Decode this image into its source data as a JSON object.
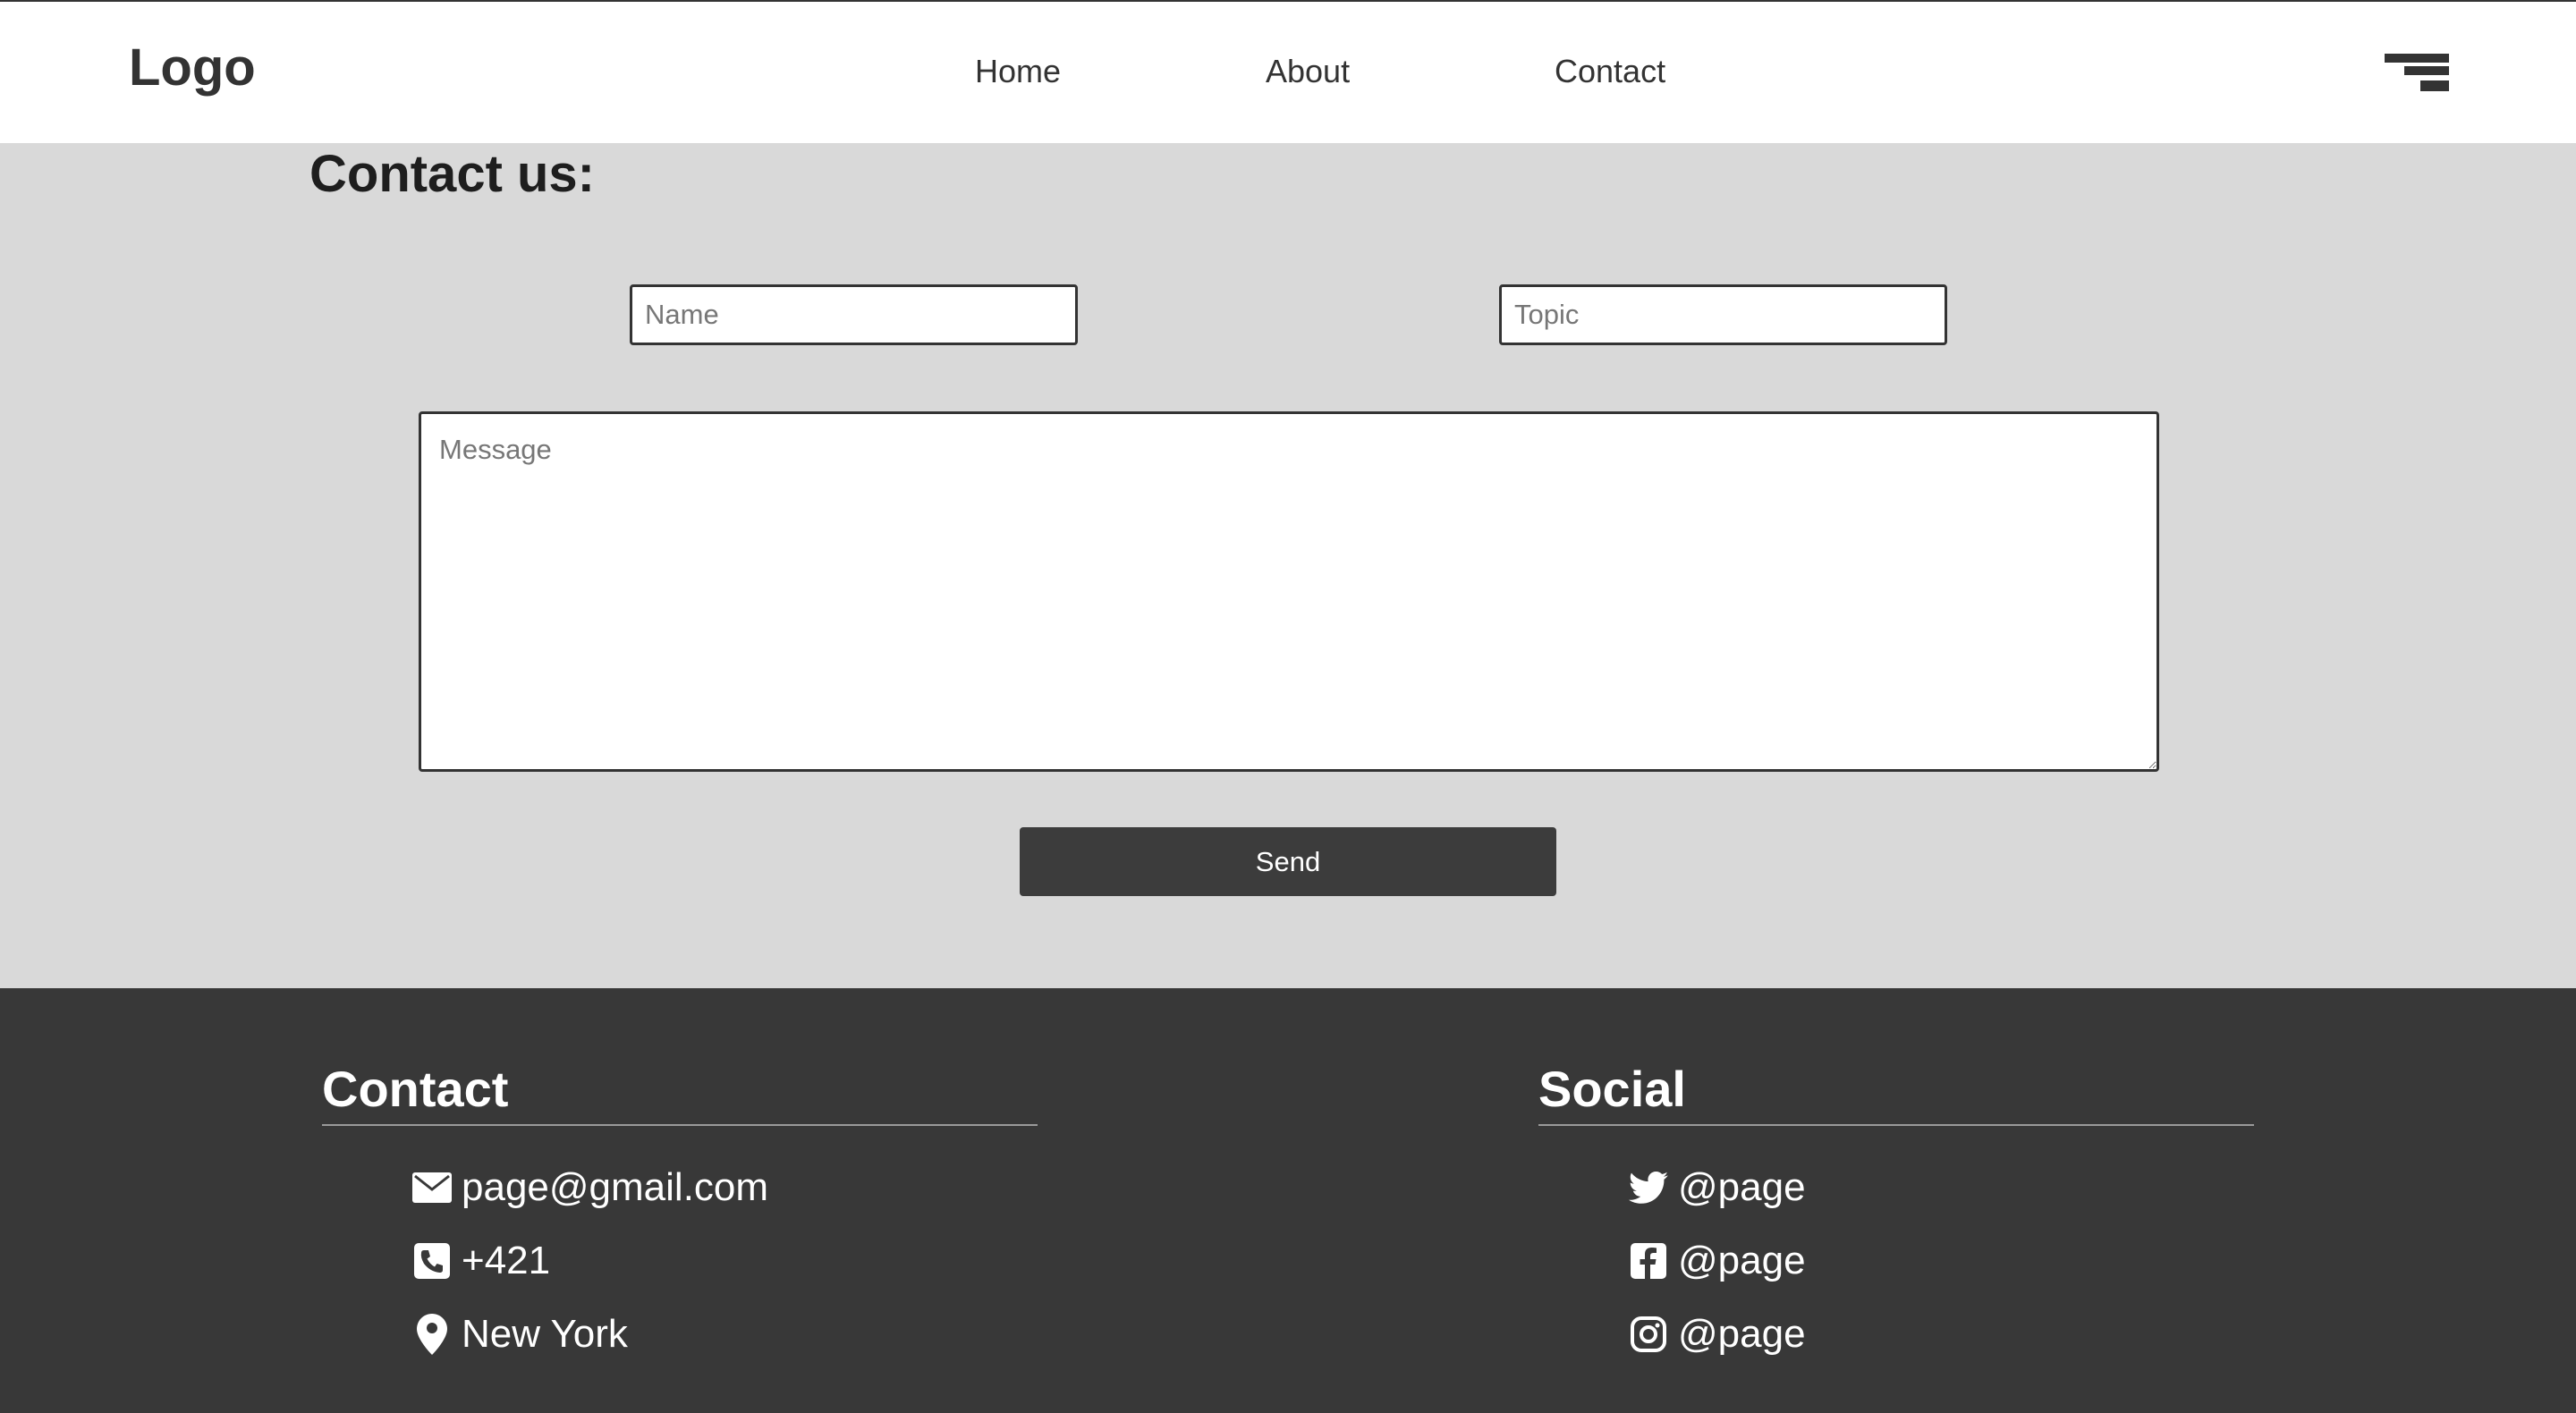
{
  "header": {
    "logo": "Logo",
    "nav": [
      "Home",
      "About",
      "Contact"
    ]
  },
  "main": {
    "title": "Contact us:",
    "form": {
      "name_placeholder": "Name",
      "topic_placeholder": "Topic",
      "message_placeholder": "Message",
      "send_label": "Send"
    }
  },
  "footer": {
    "contact": {
      "heading": "Contact",
      "items": [
        {
          "icon": "envelope-icon",
          "text": "page@gmail.com"
        },
        {
          "icon": "phone-icon",
          "text": "+421"
        },
        {
          "icon": "map-pin-icon",
          "text": "New York"
        }
      ]
    },
    "social": {
      "heading": "Social",
      "items": [
        {
          "icon": "twitter-icon",
          "text": "@page"
        },
        {
          "icon": "facebook-icon",
          "text": "@page"
        },
        {
          "icon": "instagram-icon",
          "text": "@page"
        }
      ]
    }
  },
  "colors": {
    "header_bg": "#ffffff",
    "page_bg": "#d9d9d9",
    "footer_bg": "#383838",
    "button_bg": "#3c3c3c",
    "text_dark": "#333333"
  }
}
